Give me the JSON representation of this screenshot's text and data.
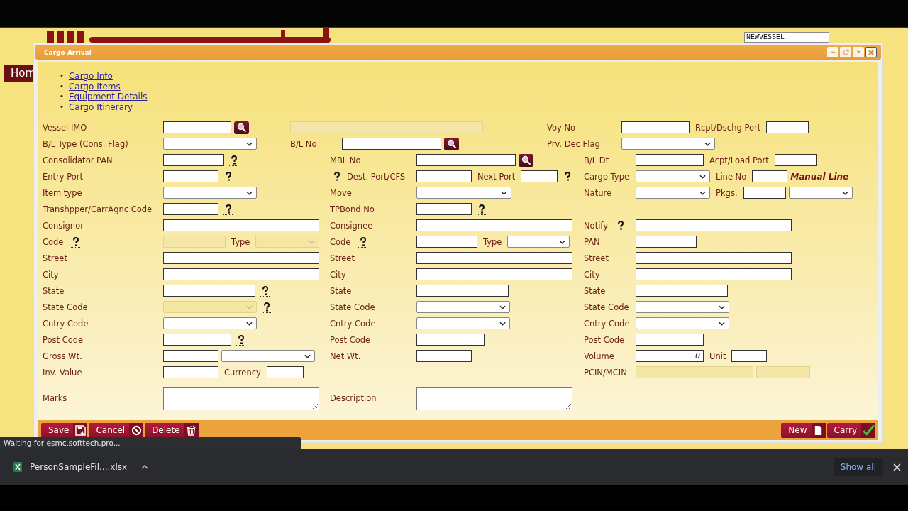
{
  "browser_page": {
    "home_button": "Hom",
    "vessel_field": {
      "value": "NEWVESSEL"
    }
  },
  "dialog": {
    "title": "Cargo Arrival",
    "links": [
      {
        "bullet": "•",
        "label": "Cargo Info"
      },
      {
        "bullet": "•",
        "label": "Cargo Items"
      },
      {
        "bullet": "•",
        "label": "Equipment Details"
      },
      {
        "bullet": "•",
        "label": "Cargo Itinerary"
      }
    ],
    "rows": [
      {
        "kind": "header",
        "left": {
          "label": "Vessel IMO",
          "fields": [
            {
              "kind": "input",
              "disabled": false
            },
            {
              "kind": "search"
            }
          ]
        },
        "mid": {
          "fields": [
            {
              "kind": "input",
              "disabled": true
            }
          ]
        },
        "right": {
          "label": "Voy No",
          "fields": [
            {
              "kind": "input",
              "disabled": false
            },
            {
              "kind": "label",
              "text": "Rcpt/Dschg Port"
            },
            {
              "kind": "input",
              "disabled": false
            }
          ]
        }
      },
      {
        "kind": "header",
        "left": {
          "label": "B/L Type (Cons. Flag)",
          "fields": [
            {
              "kind": "select",
              "disabled": false
            }
          ]
        },
        "mid": {
          "label": "B/L No",
          "fields": [
            {
              "kind": "input",
              "disabled": false
            },
            {
              "kind": "search"
            }
          ]
        },
        "right": {
          "label": "Prv. Dec Flag",
          "fields": [
            {
              "kind": "select",
              "disabled": false
            }
          ]
        }
      },
      {
        "kind": "standard",
        "left": {
          "label": "Consolidator PAN",
          "fields": [
            {
              "kind": "input",
              "disabled": false
            },
            {
              "kind": "help"
            }
          ]
        },
        "mid": {
          "label": "MBL No",
          "fields": [
            {
              "kind": "input",
              "disabled": false
            },
            {
              "kind": "search"
            }
          ]
        },
        "right": {
          "label": "B/L Dt",
          "fields": [
            {
              "kind": "input",
              "disabled": false
            },
            {
              "kind": "label",
              "text": "Acpt/Load Port"
            },
            {
              "kind": "input",
              "disabled": false
            }
          ]
        }
      },
      {
        "kind": "standard",
        "left": {
          "label": "Entry Port",
          "fields": [
            {
              "kind": "input",
              "disabled": false
            },
            {
              "kind": "help"
            }
          ]
        },
        "mid": {
          "label_items": [
            {
              "kind": "help"
            },
            {
              "kind": "label",
              "text": "Dest. Port/CFS"
            }
          ],
          "fields": [
            {
              "kind": "input",
              "disabled": false
            },
            {
              "kind": "label",
              "text": "Next Port"
            },
            {
              "kind": "input",
              "disabled": false
            },
            {
              "kind": "help"
            }
          ]
        },
        "right": {
          "label": "Cargo Type",
          "fields": [
            {
              "kind": "select",
              "disabled": false
            },
            {
              "kind": "label",
              "text": "Line No"
            },
            {
              "kind": "input",
              "disabled": false
            },
            {
              "kind": "note",
              "text": "Manual Line"
            }
          ]
        }
      },
      {
        "kind": "standard",
        "left": {
          "label": "Item type",
          "fields": [
            {
              "kind": "select",
              "disabled": false
            }
          ]
        },
        "mid": {
          "label": "Move",
          "fields": [
            {
              "kind": "select",
              "disabled": false
            }
          ]
        },
        "right": {
          "label": "Nature",
          "fields": [
            {
              "kind": "select",
              "disabled": false
            },
            {
              "kind": "label",
              "text": "Pkgs."
            },
            {
              "kind": "input",
              "disabled": false
            },
            {
              "kind": "select",
              "disabled": false
            }
          ]
        }
      },
      {
        "kind": "standard",
        "left": {
          "label": "Transhpper/CarrAgnc Code",
          "fields": [
            {
              "kind": "input",
              "disabled": false
            },
            {
              "kind": "help"
            }
          ]
        },
        "mid": {
          "label": "TPBond No",
          "fields": [
            {
              "kind": "input",
              "disabled": false
            },
            {
              "kind": "help"
            }
          ]
        }
      },
      {
        "kind": "standard",
        "left": {
          "label": "Consignor",
          "fields": [
            {
              "kind": "input",
              "disabled": false
            }
          ]
        },
        "mid": {
          "label": "Consignee",
          "fields": [
            {
              "kind": "input",
              "disabled": false
            }
          ]
        },
        "right": {
          "label_items": [
            {
              "kind": "label",
              "text": "Notify"
            },
            {
              "kind": "help"
            }
          ],
          "fields": [
            {
              "kind": "input",
              "disabled": false
            }
          ]
        }
      },
      {
        "kind": "standard",
        "left": {
          "label_items": [
            {
              "kind": "label",
              "text": "Code"
            },
            {
              "kind": "help"
            }
          ],
          "fields": [
            {
              "kind": "input",
              "disabled": true
            },
            {
              "kind": "label",
              "text": "Type"
            },
            {
              "kind": "select",
              "disabled": true
            }
          ]
        },
        "mid": {
          "label_items": [
            {
              "kind": "label",
              "text": "Code"
            },
            {
              "kind": "help"
            }
          ],
          "fields": [
            {
              "kind": "input",
              "disabled": false
            },
            {
              "kind": "label",
              "text": "Type"
            },
            {
              "kind": "select",
              "disabled": false
            }
          ]
        },
        "right": {
          "label": "PAN",
          "fields": [
            {
              "kind": "input",
              "disabled": false
            }
          ]
        }
      },
      {
        "kind": "standard",
        "left": {
          "label": "Street",
          "fields": [
            {
              "kind": "input",
              "disabled": false
            }
          ]
        },
        "mid": {
          "label": "Street",
          "fields": [
            {
              "kind": "input",
              "disabled": false
            }
          ]
        },
        "right": {
          "label": "Street",
          "fields": [
            {
              "kind": "input",
              "disabled": false
            }
          ]
        }
      },
      {
        "kind": "standard",
        "left": {
          "label": "City",
          "fields": [
            {
              "kind": "input",
              "disabled": false
            }
          ]
        },
        "mid": {
          "label": "City",
          "fields": [
            {
              "kind": "input",
              "disabled": false
            }
          ]
        },
        "right": {
          "label": "City",
          "fields": [
            {
              "kind": "input",
              "disabled": false
            }
          ]
        }
      },
      {
        "kind": "standard",
        "left": {
          "label": "State",
          "fields": [
            {
              "kind": "input",
              "disabled": false
            },
            {
              "kind": "help"
            }
          ]
        },
        "mid": {
          "label": "State",
          "fields": [
            {
              "kind": "input",
              "disabled": false
            }
          ]
        },
        "right": {
          "label": "State",
          "fields": [
            {
              "kind": "input",
              "disabled": false
            }
          ]
        }
      },
      {
        "kind": "standard",
        "left": {
          "label": "State Code",
          "fields": [
            {
              "kind": "select",
              "disabled": true
            },
            {
              "kind": "help"
            }
          ]
        },
        "mid": {
          "label": "State Code",
          "fields": [
            {
              "kind": "select",
              "disabled": false
            }
          ]
        },
        "right": {
          "label": "State Code",
          "fields": [
            {
              "kind": "select",
              "disabled": false
            }
          ]
        }
      },
      {
        "kind": "standard",
        "left": {
          "label": "Cntry Code",
          "fields": [
            {
              "kind": "select",
              "disabled": false
            }
          ]
        },
        "mid": {
          "label": "Cntry Code",
          "fields": [
            {
              "kind": "select",
              "disabled": false
            }
          ]
        },
        "right": {
          "label": "Cntry Code",
          "fields": [
            {
              "kind": "select",
              "disabled": false
            }
          ]
        }
      },
      {
        "kind": "standard",
        "left": {
          "label": "Post Code",
          "fields": [
            {
              "kind": "input",
              "disabled": false
            },
            {
              "kind": "help"
            }
          ]
        },
        "mid": {
          "label": "Post Code",
          "fields": [
            {
              "kind": "input",
              "disabled": false
            }
          ]
        },
        "right": {
          "label": "Post Code",
          "fields": [
            {
              "kind": "input",
              "disabled": false
            }
          ]
        }
      },
      {
        "kind": "standard",
        "left": {
          "label": "Gross Wt.",
          "fields": [
            {
              "kind": "input",
              "disabled": false
            },
            {
              "kind": "select",
              "disabled": false
            }
          ]
        },
        "mid": {
          "label": "Net Wt.",
          "fields": [
            {
              "kind": "input",
              "disabled": false
            }
          ]
        },
        "right": {
          "label": "Volume",
          "fields": [
            {
              "kind": "input",
              "disabled": false,
              "value": "0"
            },
            {
              "kind": "label",
              "text": "Unit"
            },
            {
              "kind": "input",
              "disabled": false
            }
          ]
        }
      },
      {
        "kind": "standard",
        "left": {
          "label": "Inv. Value",
          "fields": [
            {
              "kind": "input",
              "disabled": false
            },
            {
              "kind": "label",
              "text": "Currency"
            },
            {
              "kind": "input",
              "disabled": false
            }
          ]
        },
        "right": {
          "label": "PCIN/MCIN",
          "fields": [
            {
              "kind": "input",
              "disabled": true
            },
            {
              "kind": "input",
              "disabled": true
            }
          ]
        }
      },
      {
        "kind": "tall",
        "left": {
          "label": "Marks",
          "fields": [
            {
              "kind": "textarea",
              "disabled": false
            }
          ]
        },
        "mid": {
          "label": "Description",
          "fields": [
            {
              "kind": "textarea",
              "disabled": false
            }
          ]
        }
      }
    ],
    "footer_left": [
      {
        "label": "Save"
      },
      {
        "label": "Cancel"
      },
      {
        "label": "Delete"
      }
    ],
    "footer_right": [
      {
        "label": "New"
      },
      {
        "label": "Carry"
      }
    ]
  },
  "status_bubble": "Waiting for esmc.softtech.pro...",
  "downloads_bar": {
    "file": "PersonSampleFil....xlsx",
    "show_all": "Show all"
  }
}
